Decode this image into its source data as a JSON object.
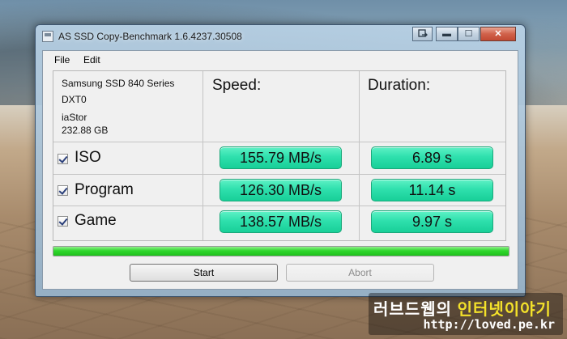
{
  "window": {
    "title": "AS SSD Copy-Benchmark 1.6.4237.30508",
    "controls": {
      "restore_label": "",
      "minimize_label": "▬",
      "maximize_label": "☐",
      "close_label": "✕"
    }
  },
  "menu": {
    "items": [
      {
        "label": "File"
      },
      {
        "label": "Edit"
      }
    ]
  },
  "device": {
    "model": "Samsung SSD 840 Series",
    "drive": "DXT0",
    "driver": "iaStor",
    "capacity": "232.88 GB"
  },
  "headers": {
    "speed": "Speed:",
    "duration": "Duration:"
  },
  "rows": [
    {
      "label": "ISO",
      "checked": true,
      "speed": "155.79 MB/s",
      "duration": "6.89 s"
    },
    {
      "label": "Program",
      "checked": true,
      "speed": "126.30 MB/s",
      "duration": "11.14 s"
    },
    {
      "label": "Game",
      "checked": true,
      "speed": "138.57 MB/s",
      "duration": "9.97 s"
    }
  ],
  "progress": {
    "value": 1.0,
    "color": "#30d72c"
  },
  "buttons": {
    "start_label": "Start",
    "abort_label": "Abort"
  },
  "colors": {
    "result_box": "#2fe0ad"
  },
  "watermark": {
    "part1": "러브드웹의 ",
    "part2": "인터넷이야기",
    "url": "http://loved.pe.kr"
  }
}
